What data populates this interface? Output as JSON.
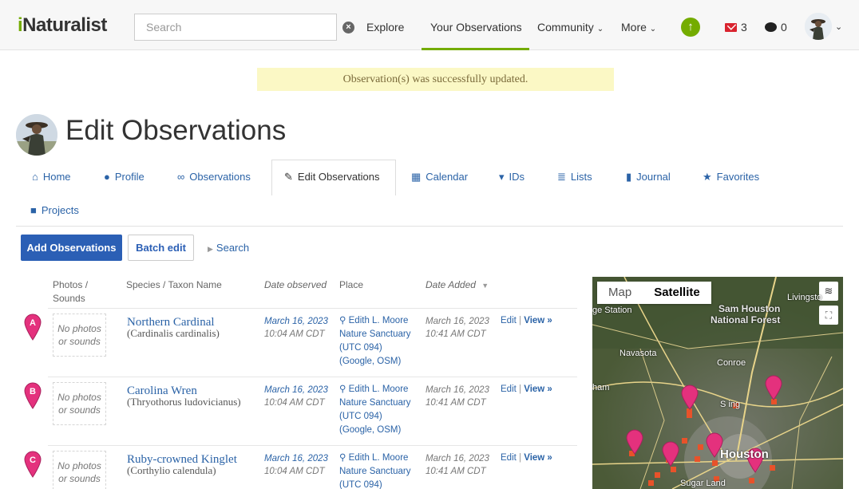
{
  "header": {
    "logo": "Naturalist",
    "logo_i": "i",
    "search_placeholder": "Search",
    "nav": [
      "Explore",
      "Your Observations",
      "Community",
      "More"
    ],
    "messages_count": "3",
    "notifications_count": "0"
  },
  "flash": "Observation(s) was successfully updated.",
  "page_title": "Edit Observations",
  "tabs": {
    "home": "Home",
    "profile": "Profile",
    "observations": "Observations",
    "edit": "Edit Observations",
    "calendar": "Calendar",
    "ids": "IDs",
    "lists": "Lists",
    "journal": "Journal",
    "favorites": "Favorites",
    "projects": "Projects"
  },
  "toolbar": {
    "add": "Add Observations",
    "batch": "Batch edit",
    "search": "Search"
  },
  "table": {
    "headers": {
      "photos": "Photos /",
      "photos2": "Sounds",
      "species": "Species / Taxon Name",
      "date_observed": "Date observed",
      "place": "Place",
      "date_added": "Date Added"
    },
    "rows": [
      {
        "marker": "A",
        "no_photos_1": "No photos",
        "no_photos_2": "or sounds",
        "common": "Northern Cardinal",
        "scientific": "(Cardinalis cardinalis)",
        "date": "March 16, 2023",
        "time": "10:04 AM CDT",
        "place_1": "Edith L. Moore",
        "place_2": "Nature Sanctuary",
        "place_3": "(UTC 094)",
        "place_4": "(Google, OSM)",
        "added_date": "March 16, 2023",
        "added_time": "10:41 AM CDT",
        "edit": "Edit",
        "sep": "|",
        "view": "View »"
      },
      {
        "marker": "B",
        "no_photos_1": "No photos",
        "no_photos_2": "or sounds",
        "common": "Carolina Wren",
        "scientific": "(Thryothorus ludovicianus)",
        "date": "March 16, 2023",
        "time": "10:04 AM CDT",
        "place_1": "Edith L. Moore",
        "place_2": "Nature Sanctuary",
        "place_3": "(UTC 094)",
        "place_4": "(Google, OSM)",
        "added_date": "March 16, 2023",
        "added_time": "10:41 AM CDT",
        "edit": "Edit",
        "sep": "|",
        "view": "View »"
      },
      {
        "marker": "C",
        "no_photos_1": "No photos",
        "no_photos_2": "or sounds",
        "common": "Ruby-crowned Kinglet",
        "scientific": "(Corthylio calendula)",
        "date": "March 16, 2023",
        "time": "10:04 AM CDT",
        "place_1": "Edith L. Moore",
        "place_2": "Nature Sanctuary",
        "place_3": "(UTC 094)",
        "place_4": "",
        "added_date": "March 16, 2023",
        "added_time": "10:41 AM CDT",
        "edit": "Edit",
        "sep": "|",
        "view": "View »"
      }
    ]
  },
  "map": {
    "tab_map": "Map",
    "tab_satellite": "Satellite",
    "labels": {
      "station": "ge Station",
      "livingston": "Livingsto",
      "sam1": "Sam Houston",
      "sam2": "National Forest",
      "navasota": "Navasota",
      "conroe": "Conroe",
      "ham": "ham",
      "spring": "S  ing",
      "houston": "Houston",
      "sugar": "Sugar Land"
    }
  },
  "colors": {
    "brand": "#74ac00",
    "link": "#2b63a7",
    "primary_button": "#2b5fb5",
    "marker": "#e4317d",
    "flash_bg": "#fbf8c5"
  }
}
